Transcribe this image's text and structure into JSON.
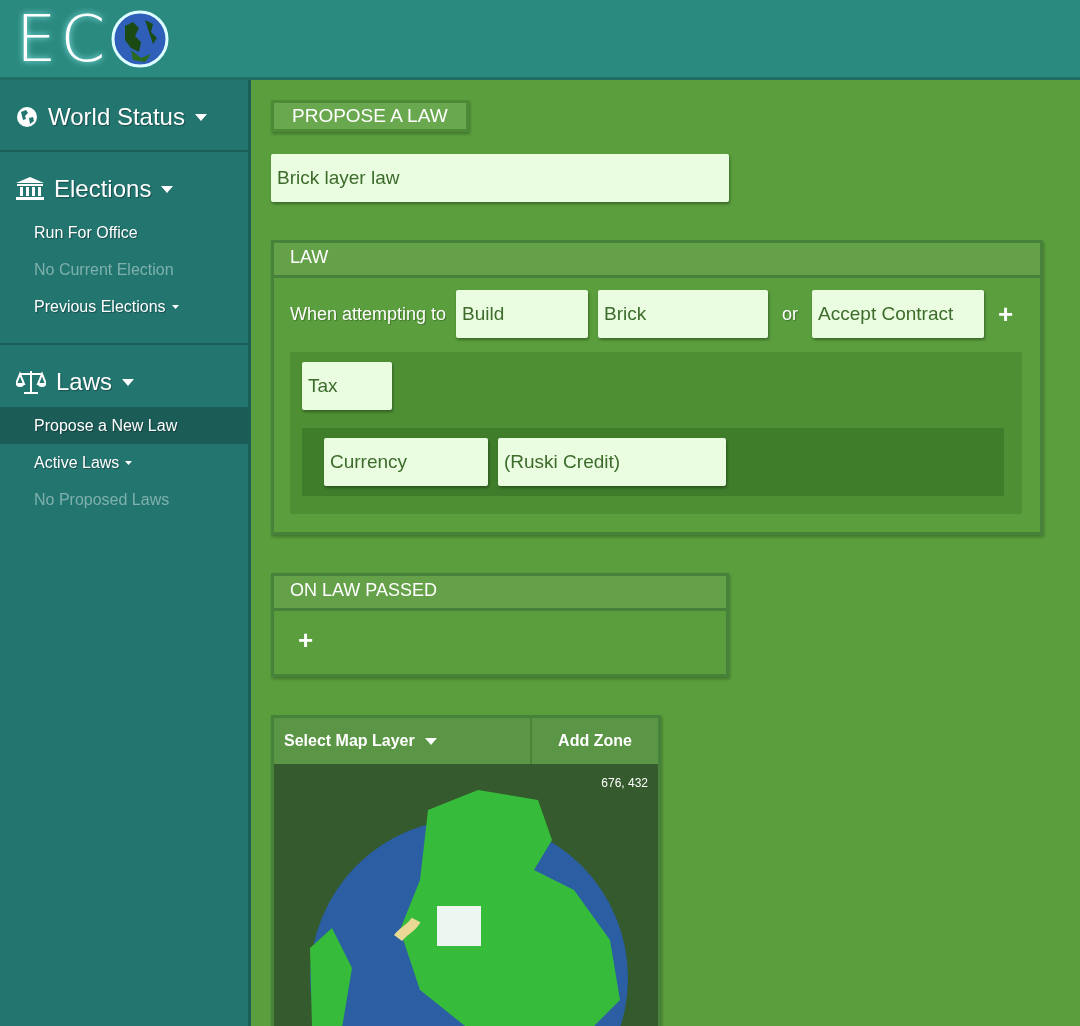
{
  "header": {
    "logo_text": "EC"
  },
  "sidebar": {
    "sections": [
      {
        "title": "World Status",
        "kind": "globe"
      },
      {
        "title": "Elections",
        "kind": "bank",
        "items": [
          {
            "label": "Run For Office",
            "disabled": false,
            "selected": false,
            "has_dropdown": false
          },
          {
            "label": "No Current Election",
            "disabled": true,
            "selected": false,
            "has_dropdown": false
          },
          {
            "label": "Previous Elections",
            "disabled": false,
            "selected": false,
            "has_dropdown": true
          }
        ]
      },
      {
        "title": "Laws",
        "kind": "scales",
        "items": [
          {
            "label": "Propose a New Law",
            "disabled": false,
            "selected": true,
            "has_dropdown": false
          },
          {
            "label": "Active Laws",
            "disabled": false,
            "selected": false,
            "has_dropdown": true
          },
          {
            "label": "No Proposed Laws",
            "disabled": true,
            "selected": false,
            "has_dropdown": false
          }
        ]
      }
    ]
  },
  "main": {
    "propose_button": "PROPOSE A LAW",
    "law_name": {
      "value": "Brick layer law"
    },
    "law_panel": {
      "title": "LAW",
      "condition_label": "When attempting to",
      "actions": [
        "Build",
        "Brick"
      ],
      "or_label": "or",
      "alternatives": [
        "Accept Contract"
      ],
      "add_button": "+",
      "effect": {
        "value": "Tax",
        "params": [
          "Currency",
          "(Ruski Credit)"
        ]
      }
    },
    "on_law_passed": {
      "title": "ON LAW PASSED",
      "add_button": "+"
    },
    "map": {
      "layer_button": "Select Map Layer",
      "add_zone_button": "Add Zone",
      "coordinates": "676, 432"
    }
  }
}
